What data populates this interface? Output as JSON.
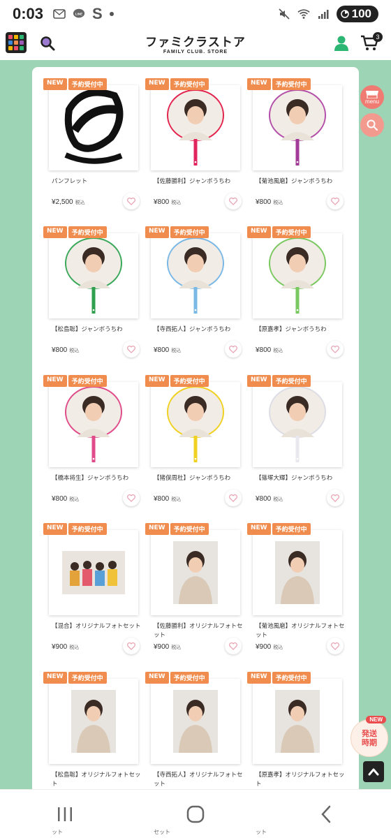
{
  "status_bar": {
    "time": "0:03",
    "carrier_icon_text": "LINE",
    "s_icon": "S",
    "battery": "100",
    "icons": [
      "message-icon",
      "line-icon",
      "s-app-icon",
      "mute-icon",
      "wifi-icon",
      "signal-icon",
      "battery-icon"
    ]
  },
  "header": {
    "logo_main": "ファミクラストア",
    "logo_sub": "FAMILY CLUB. STORE",
    "cart_count": "3",
    "grid_colors": [
      "#e94d6c",
      "#f3b400",
      "#2bb673",
      "#3b86d6",
      "#f08d4e",
      "#9b59b6",
      "#f3b400",
      "#e94d6c",
      "#2bb673"
    ]
  },
  "floating": {
    "menu_label": "menu",
    "ship_new": "NEW",
    "ship_label_1": "発送",
    "ship_label_2": "時期"
  },
  "badges": {
    "new": "NEW",
    "preorder": "予約受付中"
  },
  "tax_label": "税込",
  "products": [
    {
      "name": "パンフレット",
      "price": "¥2,500",
      "thumb": "pamphlet",
      "stick": "#222222"
    },
    {
      "name": "【佐藤勝利】ジャンボうちわ",
      "price": "¥800",
      "thumb": "uchiwa",
      "stick": "#e0245e",
      "rim": "#e2244f"
    },
    {
      "name": "【菊池風磨】ジャンボうちわ",
      "price": "¥800",
      "thumb": "uchiwa",
      "stick": "#a23a9a",
      "rim": "#b34fa8"
    },
    {
      "name": "【松島聡】ジャンボうちわ",
      "price": "¥800",
      "thumb": "uchiwa",
      "stick": "#2f9e4e",
      "rim": "#3aa85a"
    },
    {
      "name": "【寺西拓人】ジャンボうちわ",
      "price": "¥800",
      "thumb": "uchiwa",
      "stick": "#7ab8e6",
      "rim": "#7ab8e6"
    },
    {
      "name": "【原嘉孝】ジャンボうちわ",
      "price": "¥800",
      "thumb": "uchiwa",
      "stick": "#7ac860",
      "rim": "#7ac860"
    },
    {
      "name": "【橋本将生】ジャンボうちわ",
      "price": "¥800",
      "thumb": "uchiwa",
      "stick": "#e04b8a",
      "rim": "#e04b8a"
    },
    {
      "name": "【猪俣周杜】ジャンボうちわ",
      "price": "¥800",
      "thumb": "uchiwa",
      "stick": "#f0d020",
      "rim": "#f0d020"
    },
    {
      "name": "【篠塚大輝】ジャンボうちわ",
      "price": "¥800",
      "thumb": "uchiwa",
      "stick": "#e8e8ee",
      "rim": "#dddde6"
    },
    {
      "name": "【混合】オリジナルフォトセット",
      "price": "¥900",
      "thumb": "photo-wide"
    },
    {
      "name": "【佐藤勝利】オリジナルフォトセット",
      "price": "¥900",
      "thumb": "photo-tall"
    },
    {
      "name": "【菊池風磨】オリジナルフォトセット",
      "price": "¥900",
      "thumb": "photo-tall"
    },
    {
      "name": "【松島聡】オリジナルフォトセット",
      "price": "",
      "thumb": "photo-tall"
    },
    {
      "name": "【寺西拓人】オリジナルフォトセット",
      "price": "",
      "thumb": "photo-tall"
    },
    {
      "name": "【原嘉孝】オリジナルフォトセット",
      "price": "",
      "thumb": "photo-tall"
    }
  ],
  "peek_text": [
    "ット",
    "セット",
    "ット"
  ]
}
